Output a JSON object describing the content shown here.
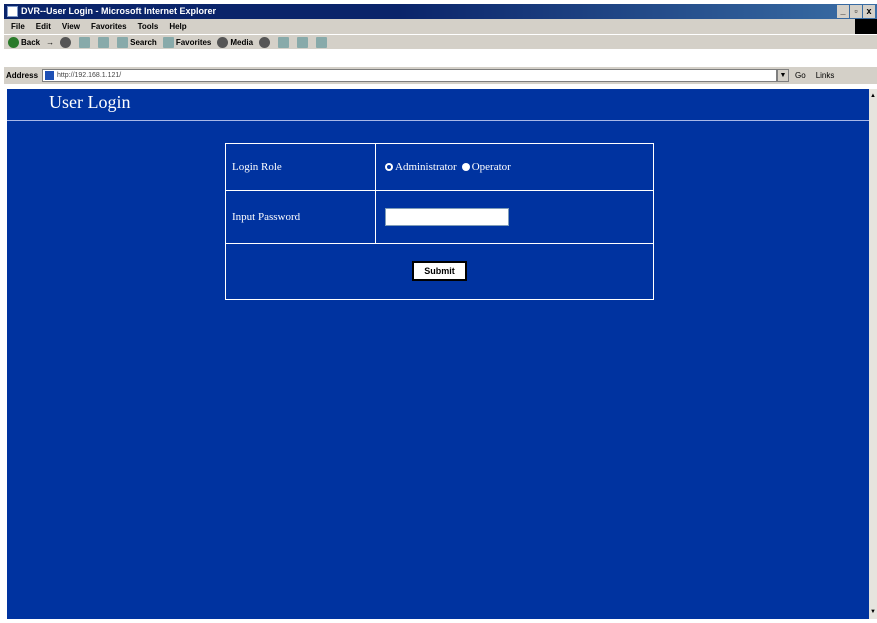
{
  "window": {
    "title": "DVR--User Login - Microsoft Internet Explorer",
    "minimize": "_",
    "maximize": "▫",
    "close": "x"
  },
  "menu": {
    "items": [
      "File",
      "Edit",
      "View",
      "Favorites",
      "Tools",
      "Help"
    ]
  },
  "toolbar": {
    "back": "Back",
    "forward": "→",
    "search": "Search",
    "favorites": "Favorites",
    "media": "Media"
  },
  "address": {
    "label": "Address",
    "url": "http://192.168.1.121/",
    "go": "Go",
    "links": "Links"
  },
  "page": {
    "title": "User Login",
    "login_role_label": "Login Role",
    "role_options": [
      {
        "label": "Administrator",
        "checked": true
      },
      {
        "label": "Operator",
        "checked": false
      }
    ],
    "password_label": "Input Password",
    "password_value": "",
    "submit_label": "Submit"
  },
  "colors": {
    "page_background": "#0033a0",
    "titlebar": "#0a246a",
    "chrome": "#d4d0c8"
  }
}
